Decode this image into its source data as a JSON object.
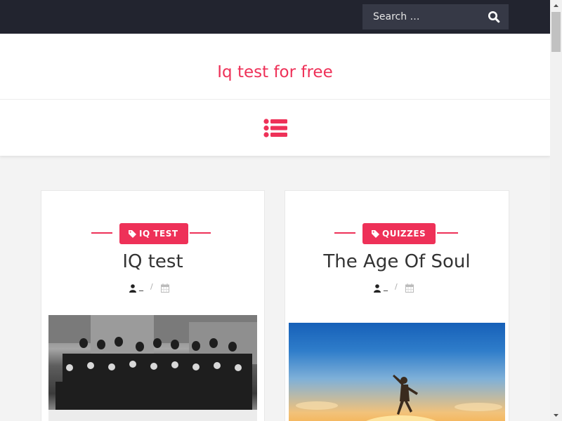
{
  "topbar": {
    "search": {
      "placeholder": "Search …",
      "value": "",
      "button_icon": "search-icon"
    }
  },
  "header": {
    "site_title": "Iq test for free",
    "menu_icon": "list-menu-icon",
    "accent_color": "#ee3158"
  },
  "posts": [
    {
      "category": "IQ TEST",
      "title": "IQ test",
      "author": "_",
      "separator": "/",
      "image": "group-photo-black-and-white"
    },
    {
      "category": "QUIZZES",
      "title": "The Age Of Soul",
      "author": "_",
      "separator": "/",
      "image": "person-jumping-at-sunset"
    }
  ],
  "colors": {
    "topbar": "#22242f",
    "search_bg": "#363946",
    "accent": "#ee3158",
    "background": "#f3f3f3"
  }
}
